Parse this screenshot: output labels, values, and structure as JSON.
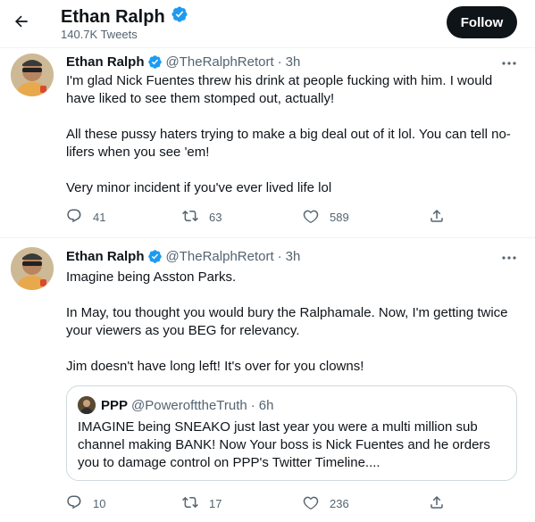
{
  "header": {
    "name": "Ethan Ralph",
    "tweet_count": "140.7K Tweets",
    "follow_label": "Follow"
  },
  "tweets": [
    {
      "name": "Ethan Ralph",
      "handle": "@TheRalphRetort",
      "dot": "·",
      "time": "3h",
      "paragraphs": [
        "I'm glad Nick Fuentes threw his drink at people fucking with him. I would have liked to see them stomped out, actually!",
        "All these pussy haters trying to make a big deal out of it lol. You can tell no-lifers when you see 'em!",
        "Very minor incident if you've ever lived life lol"
      ],
      "replies": "41",
      "retweets": "63",
      "likes": "589"
    },
    {
      "name": "Ethan Ralph",
      "handle": "@TheRalphRetort",
      "dot": "·",
      "time": "3h",
      "paragraphs": [
        "Imagine being Asston Parks.",
        "In May, tou thought you would bury the Ralphamale. Now, I'm getting twice your viewers as you BEG for relevancy.",
        "Jim doesn't have long left! It's over for you clowns!"
      ],
      "quote": {
        "name": "PPP",
        "handle": "@PowerofttheTruth",
        "dot": "·",
        "time": "6h",
        "text": "IMAGINE being SNEAKO just last year you were a multi million sub channel making BANK! Now Your boss is Nick Fuentes and he orders you to damage control on PPP's Twitter Timeline...."
      },
      "replies": "10",
      "retweets": "17",
      "likes": "236"
    }
  ],
  "colors": {
    "verified": "#1d9bf0",
    "muted": "#536471",
    "text": "#0f1419",
    "border": "#cfd9de"
  }
}
